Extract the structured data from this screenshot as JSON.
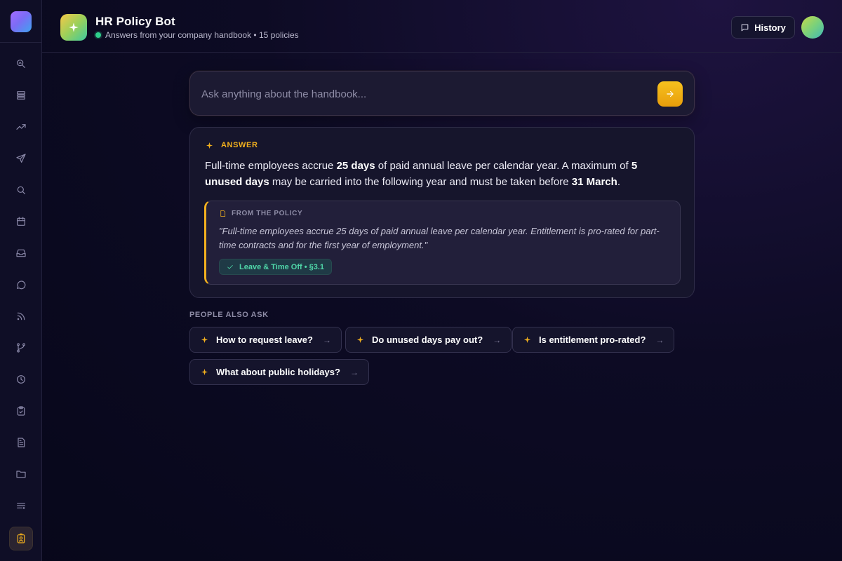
{
  "sidebar": {
    "items": [
      {
        "name": "search-insights-icon",
        "active": false
      },
      {
        "name": "layers-icon",
        "active": false
      },
      {
        "name": "trend-icon",
        "active": false
      },
      {
        "name": "send-icon",
        "active": false
      },
      {
        "name": "search-icon",
        "active": false
      },
      {
        "name": "calendar-icon",
        "active": false
      },
      {
        "name": "inbox-icon",
        "active": false
      },
      {
        "name": "chat-icon",
        "active": false
      },
      {
        "name": "rss-icon",
        "active": false
      },
      {
        "name": "branch-icon",
        "active": false
      },
      {
        "name": "clock-icon",
        "active": false
      },
      {
        "name": "clipboard-check-icon",
        "active": false
      },
      {
        "name": "document-icon",
        "active": false
      },
      {
        "name": "folder-icon",
        "active": false
      },
      {
        "name": "list-icon",
        "active": false
      },
      {
        "name": "contact-badge-icon",
        "active": true
      }
    ]
  },
  "header": {
    "title": "HR Policy Bot",
    "subtitle": "Answers from your company handbook • 15 policies",
    "history_label": "History"
  },
  "search": {
    "placeholder": "Ask anything about the handbook..."
  },
  "answer": {
    "label": "ANSWER",
    "parts": {
      "p1": "Full-time employees accrue ",
      "b1": "25 days",
      "p2": " of paid annual leave per calendar year. A maximum of ",
      "b2": "5 unused days",
      "p3": " may be carried into the following year and must be taken before ",
      "b3": "31 March",
      "p4": "."
    },
    "policy_label": "FROM THE POLICY",
    "policy_quote": "\"Full-time employees accrue 25 days of paid annual leave per calendar year. Entitlement is pro-rated for part-time contracts and for the first year of employment.\"",
    "policy_tag": "Leave & Time Off • §3.1"
  },
  "people_also_ask": {
    "title": "PEOPLE ALSO ASK",
    "questions": [
      "How to request leave?",
      "Do unused days pay out?",
      "Is entitlement pro-rated?",
      "What about public holidays?"
    ],
    "arrow": "→"
  },
  "colors": {
    "accent": "#f2b01e",
    "background": "#0d0b24",
    "success": "#4fd6a8",
    "status_online": "#2ecf8c"
  }
}
